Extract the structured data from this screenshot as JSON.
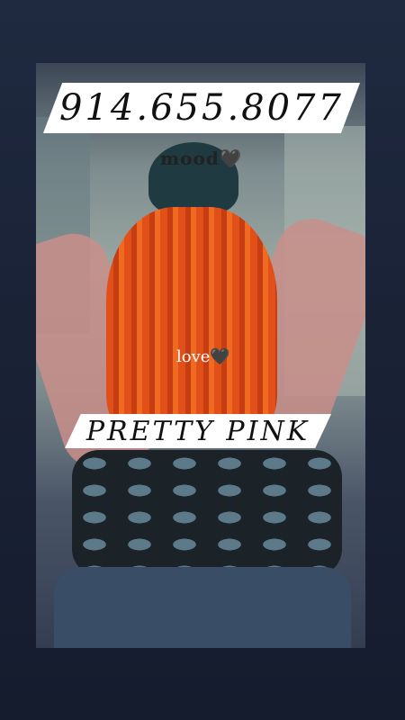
{
  "story": {
    "phone": "914.655.8077",
    "mood_text": "mood🖤",
    "love_text": "love🖤",
    "name_banner": "PRETTY PINK"
  }
}
